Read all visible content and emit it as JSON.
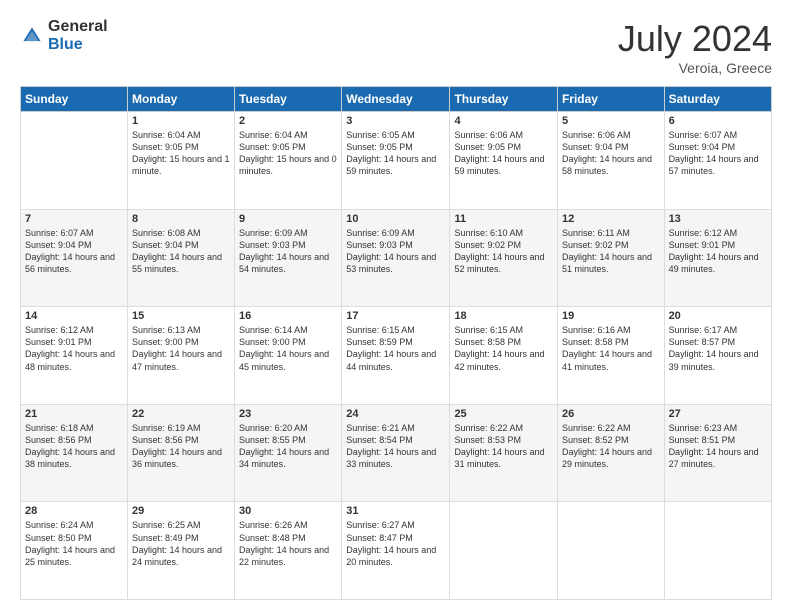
{
  "logo": {
    "general": "General",
    "blue": "Blue"
  },
  "title": {
    "month_year": "July 2024",
    "location": "Veroia, Greece"
  },
  "days_of_week": [
    "Sunday",
    "Monday",
    "Tuesday",
    "Wednesday",
    "Thursday",
    "Friday",
    "Saturday"
  ],
  "weeks": [
    [
      {
        "day": "",
        "info": ""
      },
      {
        "day": "1",
        "info": "Sunrise: 6:04 AM\nSunset: 9:05 PM\nDaylight: 15 hours\nand 1 minute."
      },
      {
        "day": "2",
        "info": "Sunrise: 6:04 AM\nSunset: 9:05 PM\nDaylight: 15 hours\nand 0 minutes."
      },
      {
        "day": "3",
        "info": "Sunrise: 6:05 AM\nSunset: 9:05 PM\nDaylight: 14 hours\nand 59 minutes."
      },
      {
        "day": "4",
        "info": "Sunrise: 6:06 AM\nSunset: 9:05 PM\nDaylight: 14 hours\nand 59 minutes."
      },
      {
        "day": "5",
        "info": "Sunrise: 6:06 AM\nSunset: 9:04 PM\nDaylight: 14 hours\nand 58 minutes."
      },
      {
        "day": "6",
        "info": "Sunrise: 6:07 AM\nSunset: 9:04 PM\nDaylight: 14 hours\nand 57 minutes."
      }
    ],
    [
      {
        "day": "7",
        "info": "Sunrise: 6:07 AM\nSunset: 9:04 PM\nDaylight: 14 hours\nand 56 minutes."
      },
      {
        "day": "8",
        "info": "Sunrise: 6:08 AM\nSunset: 9:04 PM\nDaylight: 14 hours\nand 55 minutes."
      },
      {
        "day": "9",
        "info": "Sunrise: 6:09 AM\nSunset: 9:03 PM\nDaylight: 14 hours\nand 54 minutes."
      },
      {
        "day": "10",
        "info": "Sunrise: 6:09 AM\nSunset: 9:03 PM\nDaylight: 14 hours\nand 53 minutes."
      },
      {
        "day": "11",
        "info": "Sunrise: 6:10 AM\nSunset: 9:02 PM\nDaylight: 14 hours\nand 52 minutes."
      },
      {
        "day": "12",
        "info": "Sunrise: 6:11 AM\nSunset: 9:02 PM\nDaylight: 14 hours\nand 51 minutes."
      },
      {
        "day": "13",
        "info": "Sunrise: 6:12 AM\nSunset: 9:01 PM\nDaylight: 14 hours\nand 49 minutes."
      }
    ],
    [
      {
        "day": "14",
        "info": "Sunrise: 6:12 AM\nSunset: 9:01 PM\nDaylight: 14 hours\nand 48 minutes."
      },
      {
        "day": "15",
        "info": "Sunrise: 6:13 AM\nSunset: 9:00 PM\nDaylight: 14 hours\nand 47 minutes."
      },
      {
        "day": "16",
        "info": "Sunrise: 6:14 AM\nSunset: 9:00 PM\nDaylight: 14 hours\nand 45 minutes."
      },
      {
        "day": "17",
        "info": "Sunrise: 6:15 AM\nSunset: 8:59 PM\nDaylight: 14 hours\nand 44 minutes."
      },
      {
        "day": "18",
        "info": "Sunrise: 6:15 AM\nSunset: 8:58 PM\nDaylight: 14 hours\nand 42 minutes."
      },
      {
        "day": "19",
        "info": "Sunrise: 6:16 AM\nSunset: 8:58 PM\nDaylight: 14 hours\nand 41 minutes."
      },
      {
        "day": "20",
        "info": "Sunrise: 6:17 AM\nSunset: 8:57 PM\nDaylight: 14 hours\nand 39 minutes."
      }
    ],
    [
      {
        "day": "21",
        "info": "Sunrise: 6:18 AM\nSunset: 8:56 PM\nDaylight: 14 hours\nand 38 minutes."
      },
      {
        "day": "22",
        "info": "Sunrise: 6:19 AM\nSunset: 8:56 PM\nDaylight: 14 hours\nand 36 minutes."
      },
      {
        "day": "23",
        "info": "Sunrise: 6:20 AM\nSunset: 8:55 PM\nDaylight: 14 hours\nand 34 minutes."
      },
      {
        "day": "24",
        "info": "Sunrise: 6:21 AM\nSunset: 8:54 PM\nDaylight: 14 hours\nand 33 minutes."
      },
      {
        "day": "25",
        "info": "Sunrise: 6:22 AM\nSunset: 8:53 PM\nDaylight: 14 hours\nand 31 minutes."
      },
      {
        "day": "26",
        "info": "Sunrise: 6:22 AM\nSunset: 8:52 PM\nDaylight: 14 hours\nand 29 minutes."
      },
      {
        "day": "27",
        "info": "Sunrise: 6:23 AM\nSunset: 8:51 PM\nDaylight: 14 hours\nand 27 minutes."
      }
    ],
    [
      {
        "day": "28",
        "info": "Sunrise: 6:24 AM\nSunset: 8:50 PM\nDaylight: 14 hours\nand 25 minutes."
      },
      {
        "day": "29",
        "info": "Sunrise: 6:25 AM\nSunset: 8:49 PM\nDaylight: 14 hours\nand 24 minutes."
      },
      {
        "day": "30",
        "info": "Sunrise: 6:26 AM\nSunset: 8:48 PM\nDaylight: 14 hours\nand 22 minutes."
      },
      {
        "day": "31",
        "info": "Sunrise: 6:27 AM\nSunset: 8:47 PM\nDaylight: 14 hours\nand 20 minutes."
      },
      {
        "day": "",
        "info": ""
      },
      {
        "day": "",
        "info": ""
      },
      {
        "day": "",
        "info": ""
      }
    ]
  ]
}
